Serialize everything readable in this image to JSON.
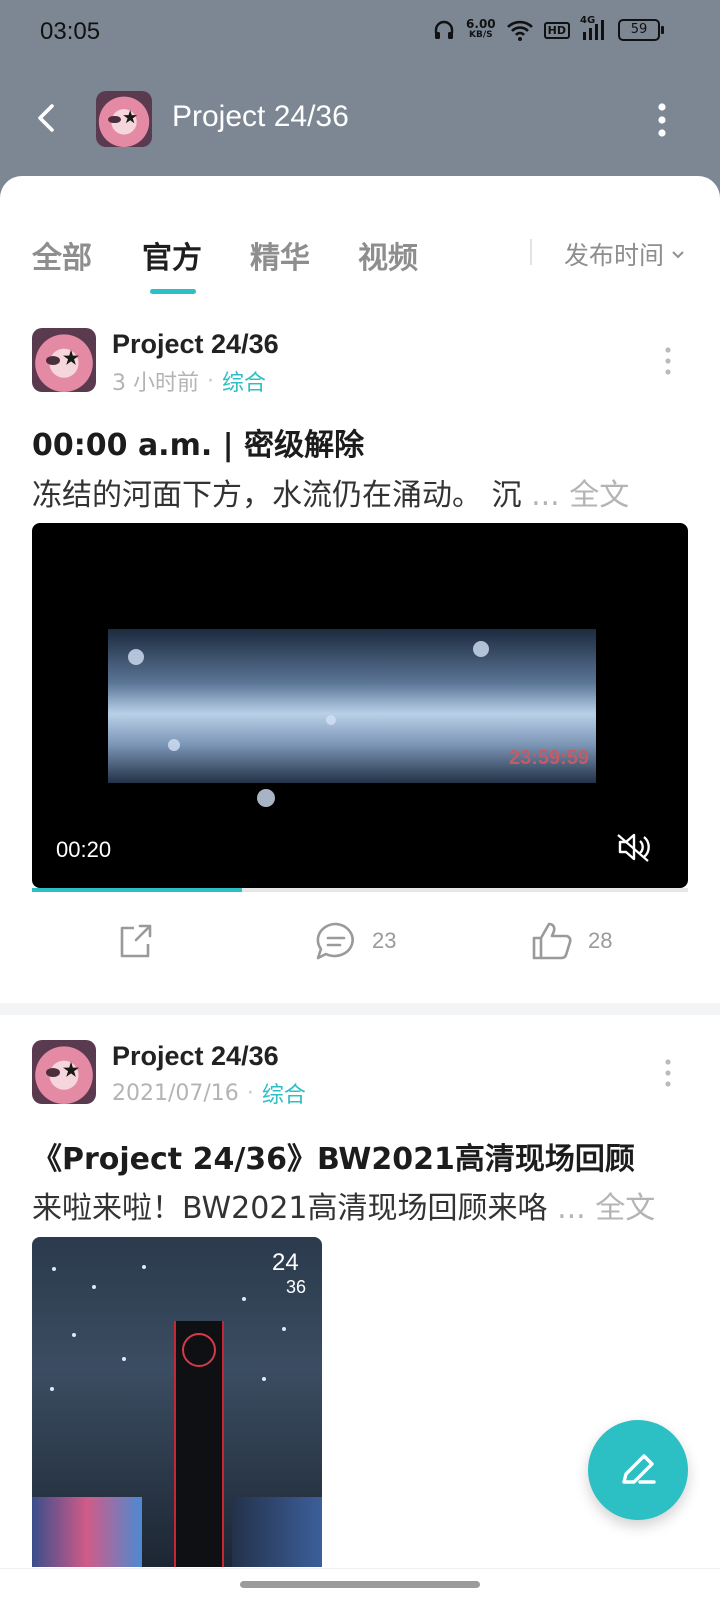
{
  "status_bar": {
    "time": "03:05",
    "net_speed_value": "6.00",
    "net_speed_unit": "KB/S",
    "hd_label": "HD",
    "network_type": "4G",
    "battery": "59"
  },
  "header": {
    "title": "Project 24/36"
  },
  "tabs": {
    "items": [
      {
        "label": "全部"
      },
      {
        "label": "官方"
      },
      {
        "label": "精华"
      },
      {
        "label": "视频"
      }
    ],
    "active": "官方",
    "sort_label": "发布时间"
  },
  "posts": [
    {
      "author": "Project 24/36",
      "time": "3 小时前",
      "category": "综合",
      "title": "00:00 a.m. | 密级解除",
      "excerpt": "冻结的河面下方，水流仍在涌动。 沉",
      "more_label": "... 全文",
      "video": {
        "current_time": "00:20",
        "overlay_timestamp": "23:59:59",
        "progress": 0.32
      },
      "comments": "23",
      "likes": "28"
    },
    {
      "author": "Project 24/36",
      "time": "2021/07/16",
      "category": "综合",
      "title": "《Project 24/36》BW2021高清现场回顾",
      "excerpt": "来啦来啦！BW2021高清现场回顾来咯",
      "more_label": "... 全文",
      "image_logo_top": "24",
      "image_logo_bottom": "36"
    }
  ],
  "colors": {
    "accent": "#2cbfc4",
    "header_bg": "#7d8794"
  }
}
